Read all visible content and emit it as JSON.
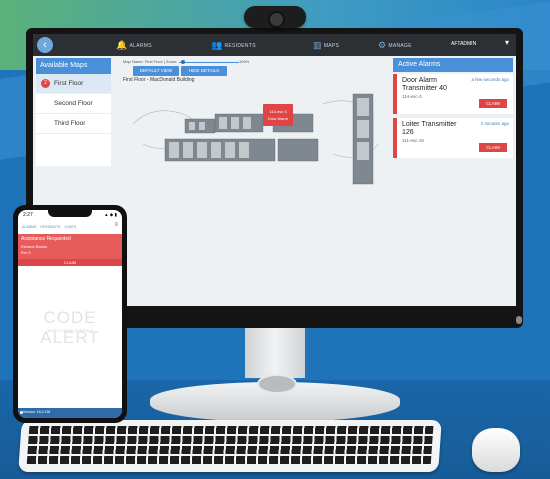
{
  "webapp": {
    "nav": [
      {
        "label": "ALARMS",
        "icon": "bell-icon"
      },
      {
        "label": "RESIDENTS",
        "icon": "users-icon"
      },
      {
        "label": "MAPS",
        "icon": "map-icon"
      },
      {
        "label": "MANAGE",
        "icon": "gears-icon"
      }
    ],
    "user": "AFTADMIN",
    "available_maps": {
      "title": "Available Maps",
      "floors": [
        {
          "label": "First Floor",
          "badge": "2"
        },
        {
          "label": "Second Floor"
        },
        {
          "label": "Third Floor"
        }
      ]
    },
    "map": {
      "zoom_label": "Map Name: First Floor | Zoom:",
      "zoom_value": "100%",
      "zoom_level": 0.07,
      "default_view": "DEFAULT VIEW",
      "hide_details": "HIDE DETAILS",
      "title": "First Floor - MacDonald Building",
      "marker_line1": "114-esc 3",
      "marker_line2": "Door Alarm"
    },
    "active_alarms": {
      "title": "Active Alarms",
      "items": [
        {
          "name": "Door Alarm Transmitter 40",
          "code": "114-esc-3",
          "time": "a few seconds ago",
          "claim": "CLAIM"
        },
        {
          "name": "Loiter Transmitter 126",
          "code": "111-esc-16",
          "time": "2 minutes ago",
          "claim": "CLAIM"
        }
      ]
    }
  },
  "phone": {
    "time": "2:27",
    "status": "▲ ◆ ▮",
    "nav": [
      "ALARMS",
      "RESIDENTS",
      "CHATS"
    ],
    "alert_title": "Assistance Requested",
    "alert_name": "Eleanor Banks",
    "alert_room": "Rm 2",
    "claim": "CLAIM",
    "logo": "CODE ALERT",
    "tagline": "Senior Living Solutions",
    "footer": "Version: 16.0.138"
  },
  "colors": {
    "accent": "#4a90d9",
    "alarm": "#e04545",
    "topbar": "#2c2f33"
  }
}
